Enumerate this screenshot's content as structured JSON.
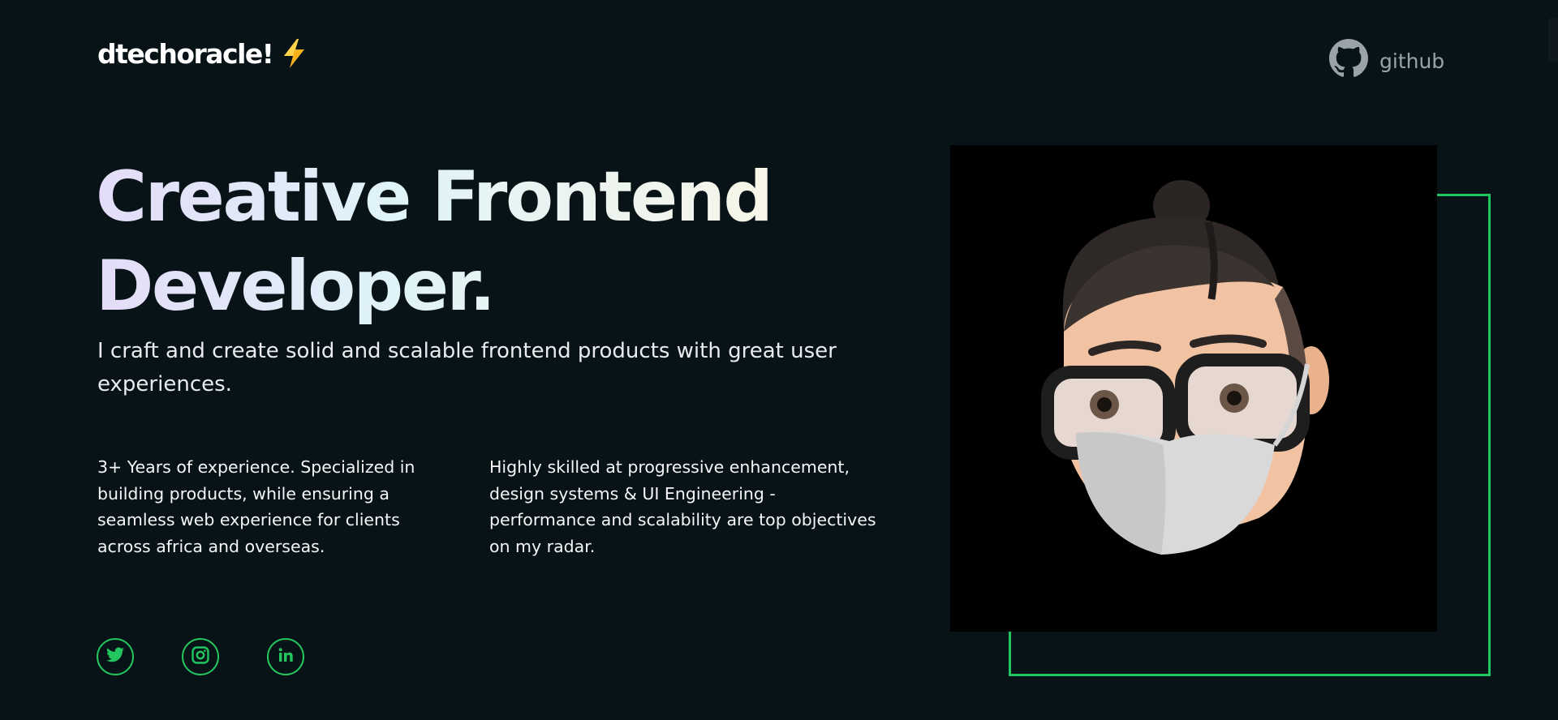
{
  "header": {
    "logo_text": "dtechoracle!",
    "logo_icon": "lightning-bolt-icon",
    "github_label": "github",
    "github_icon": "github-octocat-icon"
  },
  "hero": {
    "title_line1": "Creative Frontend",
    "title_line2": "Developer.",
    "lead": "I craft and create solid and scalable frontend products with great user experiences.",
    "column1": "3+ Years of experience. Specialized in building products, while ensuring a seamless web experience for clients across africa and overseas.",
    "column2": "Highly skilled at progressive enhancement, design systems & UI Engineering - performance and scalability are top objectives on my radar."
  },
  "socials": [
    {
      "icon": "twitter-icon"
    },
    {
      "icon": "instagram-icon"
    },
    {
      "icon": "linkedin-icon"
    }
  ],
  "avatar": {
    "image": "memoji-avatar-with-glasses-and-mask"
  },
  "colors": {
    "background": "#081318",
    "accent": "#22c55e",
    "text": "#f3f5f7",
    "muted": "#9aa3a8"
  }
}
